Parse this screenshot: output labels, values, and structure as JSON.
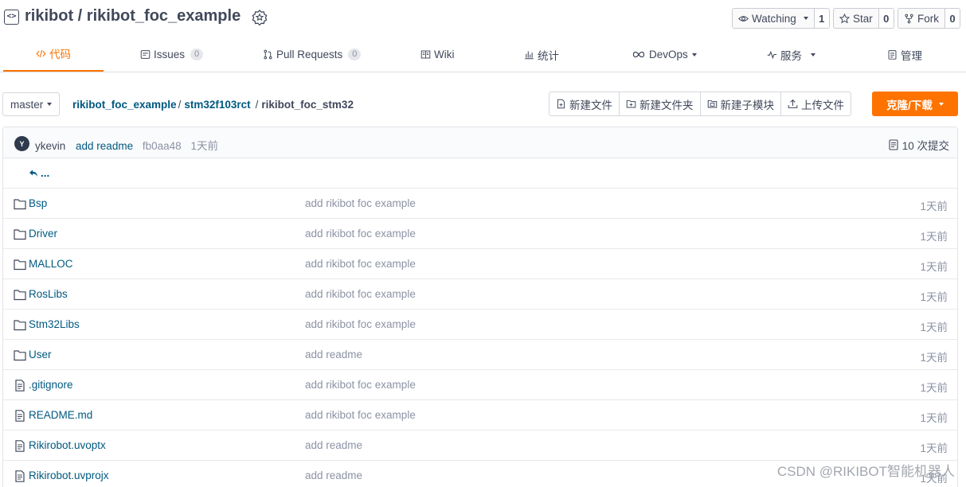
{
  "repo": {
    "owner": "rikibot",
    "separator": " / ",
    "name": "rikibot_foc_example"
  },
  "actions": {
    "watching_label": "Watching",
    "watching_count": "1",
    "star_label": "Star",
    "star_count": "0",
    "fork_label": "Fork",
    "fork_count": "0"
  },
  "tabs": [
    {
      "label": "代码",
      "icon": "code-icon"
    },
    {
      "label": "Issues",
      "count": "0",
      "icon": "issue-icon"
    },
    {
      "label": "Pull Requests",
      "count": "0",
      "icon": "pull-request-icon"
    },
    {
      "label": "Wiki",
      "icon": "book-icon"
    },
    {
      "label": "统计",
      "icon": "bar-chart-icon"
    },
    {
      "label": "DevOps",
      "icon": "infinity-icon"
    },
    {
      "label": "服务",
      "icon": "pulse-icon"
    },
    {
      "label": "管理",
      "icon": "clipboard-icon"
    }
  ],
  "branch": "master",
  "breadcrumb": {
    "part1": "rikibot_foc_example",
    "part2": "stm32f103rct",
    "sep": "/",
    "current": "rikibot_foc_stm32"
  },
  "file_actions": {
    "new_file": "新建文件",
    "new_folder": "新建文件夹",
    "new_submodule": "新建子模块",
    "upload": "上传文件",
    "clone": "克隆/下载"
  },
  "commit": {
    "avatar_letter": "Y",
    "author": "ykevin",
    "message": "add readme",
    "sha": "fb0aa48",
    "time": "1天前",
    "count": "10 次提交"
  },
  "parent_label": "...",
  "files": [
    {
      "name": "Bsp",
      "type": "folder",
      "message": "add rikibot foc example",
      "time": "1天前"
    },
    {
      "name": "Driver",
      "type": "folder",
      "message": "add rikibot foc example",
      "time": "1天前"
    },
    {
      "name": "MALLOC",
      "type": "folder",
      "message": "add rikibot foc example",
      "time": "1天前"
    },
    {
      "name": "RosLibs",
      "type": "folder",
      "message": "add rikibot foc example",
      "time": "1天前"
    },
    {
      "name": "Stm32Libs",
      "type": "folder",
      "message": "add rikibot foc example",
      "time": "1天前"
    },
    {
      "name": "User",
      "type": "folder",
      "message": "add readme",
      "time": "1天前"
    },
    {
      "name": ".gitignore",
      "type": "file",
      "message": "add rikibot foc example",
      "time": "1天前"
    },
    {
      "name": "README.md",
      "type": "file",
      "message": "add rikibot foc example",
      "time": "1天前"
    },
    {
      "name": "Rikirobot.uvoptx",
      "type": "file",
      "message": "add readme",
      "time": "1天前"
    },
    {
      "name": "Rikirobot.uvprojx",
      "type": "file",
      "message": "add readme",
      "time": "1天前"
    }
  ],
  "watermark": "CSDN @RIKIBOT智能机器人",
  "colors": {
    "accent": "#fe7300",
    "link": "#005980",
    "muted": "#8c92a4",
    "text": "#40485b"
  }
}
